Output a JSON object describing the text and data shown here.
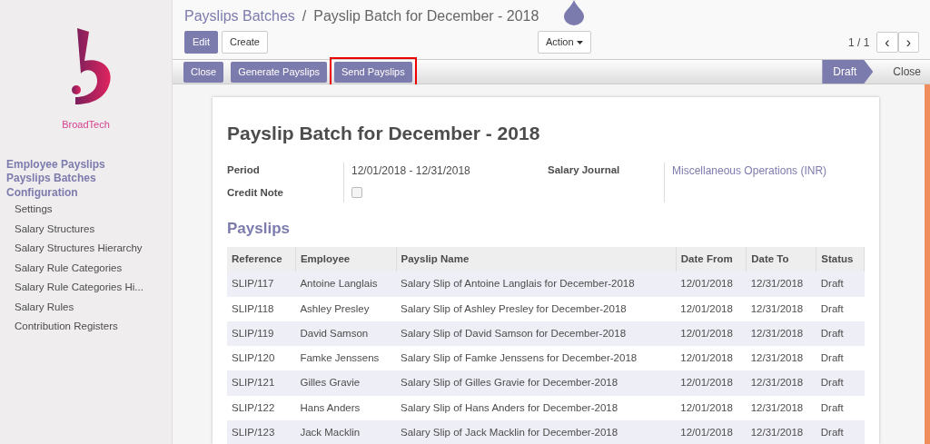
{
  "sidebar": {
    "brand": "BroadTech",
    "menus": [
      {
        "label": "Employee Payslips",
        "kind": "section"
      },
      {
        "label": "Payslips Batches",
        "kind": "section"
      },
      {
        "label": "Configuration",
        "kind": "section"
      },
      {
        "label": "Settings",
        "kind": "item"
      },
      {
        "label": "Salary Structures",
        "kind": "item"
      },
      {
        "label": "Salary Structures Hierarchy",
        "kind": "item"
      },
      {
        "label": "Salary Rule Categories",
        "kind": "item"
      },
      {
        "label": "Salary Rule Categories Hi...",
        "kind": "item"
      },
      {
        "label": "Salary Rules",
        "kind": "item"
      },
      {
        "label": "Contribution Registers",
        "kind": "item"
      }
    ]
  },
  "breadcrumb_separator": "/",
  "breadcrumb": [
    {
      "label": "Payslips Batches",
      "kind": "link"
    },
    {
      "label": "Payslip Batch for December - 2018",
      "kind": "current"
    }
  ],
  "control_panel": {
    "buttons": [
      {
        "label": "Edit",
        "kind": "primary"
      },
      {
        "label": "Create",
        "kind": "default"
      }
    ],
    "action": "Action",
    "pager": "1 / 1",
    "pager_prev": "‹",
    "pager_next": "›"
  },
  "header": {
    "buttons": [
      {
        "label": "Close",
        "highlighted": false
      },
      {
        "label": "Generate Payslips",
        "highlighted": false
      },
      {
        "label": "Send Payslips",
        "highlighted": true
      }
    ],
    "stages": [
      {
        "label": "Draft",
        "selected": true
      },
      {
        "label": "Close",
        "selected": false
      }
    ]
  },
  "sheet": {
    "title": "Payslip Batch for December - 2018",
    "fields_left": [
      {
        "label": "Period",
        "kind": "text",
        "value": "12/01/2018 - 12/31/2018"
      },
      {
        "label": "Credit Note",
        "kind": "checkbox",
        "checked": false
      }
    ],
    "fields_right": [
      {
        "label": "Salary Journal",
        "kind": "link",
        "value": "Miscellaneous Operations (INR)"
      }
    ],
    "section": "Payslips",
    "table": {
      "columns": [
        "Reference",
        "Employee",
        "Payslip Name",
        "Date From",
        "Date To",
        "Status"
      ],
      "rows": [
        [
          "SLIP/117",
          "Antoine Langlais",
          "Salary Slip of Antoine Langlais for December-2018",
          "12/01/2018",
          "12/31/2018",
          "Draft"
        ],
        [
          "SLIP/118",
          "Ashley Presley",
          "Salary Slip of Ashley Presley for December-2018",
          "12/01/2018",
          "12/31/2018",
          "Draft"
        ],
        [
          "SLIP/119",
          "David Samson",
          "Salary Slip of David Samson for December-2018",
          "12/01/2018",
          "12/31/2018",
          "Draft"
        ],
        [
          "SLIP/120",
          "Famke Jenssens",
          "Salary Slip of Famke Jenssens for December-2018",
          "12/01/2018",
          "12/31/2018",
          "Draft"
        ],
        [
          "SLIP/121",
          "Gilles Gravie",
          "Salary Slip of Gilles Gravie for December-2018",
          "12/01/2018",
          "12/31/2018",
          "Draft"
        ],
        [
          "SLIP/122",
          "Hans Anders",
          "Salary Slip of Hans Anders for December-2018",
          "12/01/2018",
          "12/31/2018",
          "Draft"
        ],
        [
          "SLIP/123",
          "Jack Macklin",
          "Salary Slip of Jack Macklin for December-2018",
          "12/01/2018",
          "12/31/2018",
          "Draft"
        ]
      ]
    }
  }
}
